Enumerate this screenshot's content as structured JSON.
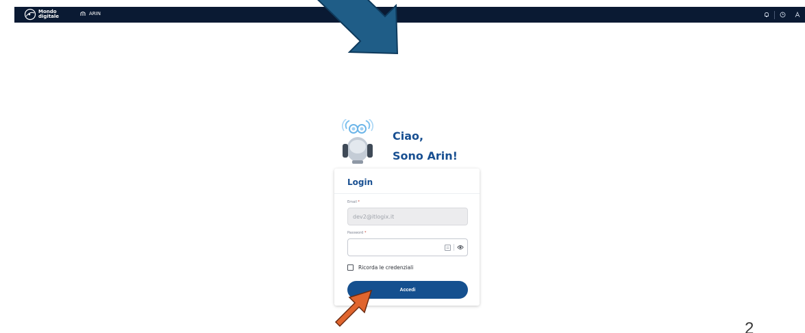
{
  "topbar": {
    "brand_line1": "Mondo",
    "brand_line2": "digitale",
    "app_label": "ARIN",
    "icons": [
      "bell-icon",
      "clock-icon",
      "user-icon"
    ],
    "background_color": "#0a1a33"
  },
  "hero": {
    "greeting_line1": "Ciao,",
    "greeting_line2": "Sono Arin!"
  },
  "login": {
    "title": "Login",
    "email_label": "Email",
    "email_value": "dev2@itlogix.it",
    "password_label": "Password",
    "password_value": "",
    "required_mark": "*",
    "remember_label": "Ricorda le credenziali",
    "remember_checked": false,
    "submit_label": "Accedi"
  },
  "slide": {
    "page_number": "2"
  },
  "colors": {
    "brand_blue": "#184f91",
    "button_blue": "#15508f",
    "arrow_blue": "#1f5d87",
    "arrow_orange": "#e0652e"
  }
}
